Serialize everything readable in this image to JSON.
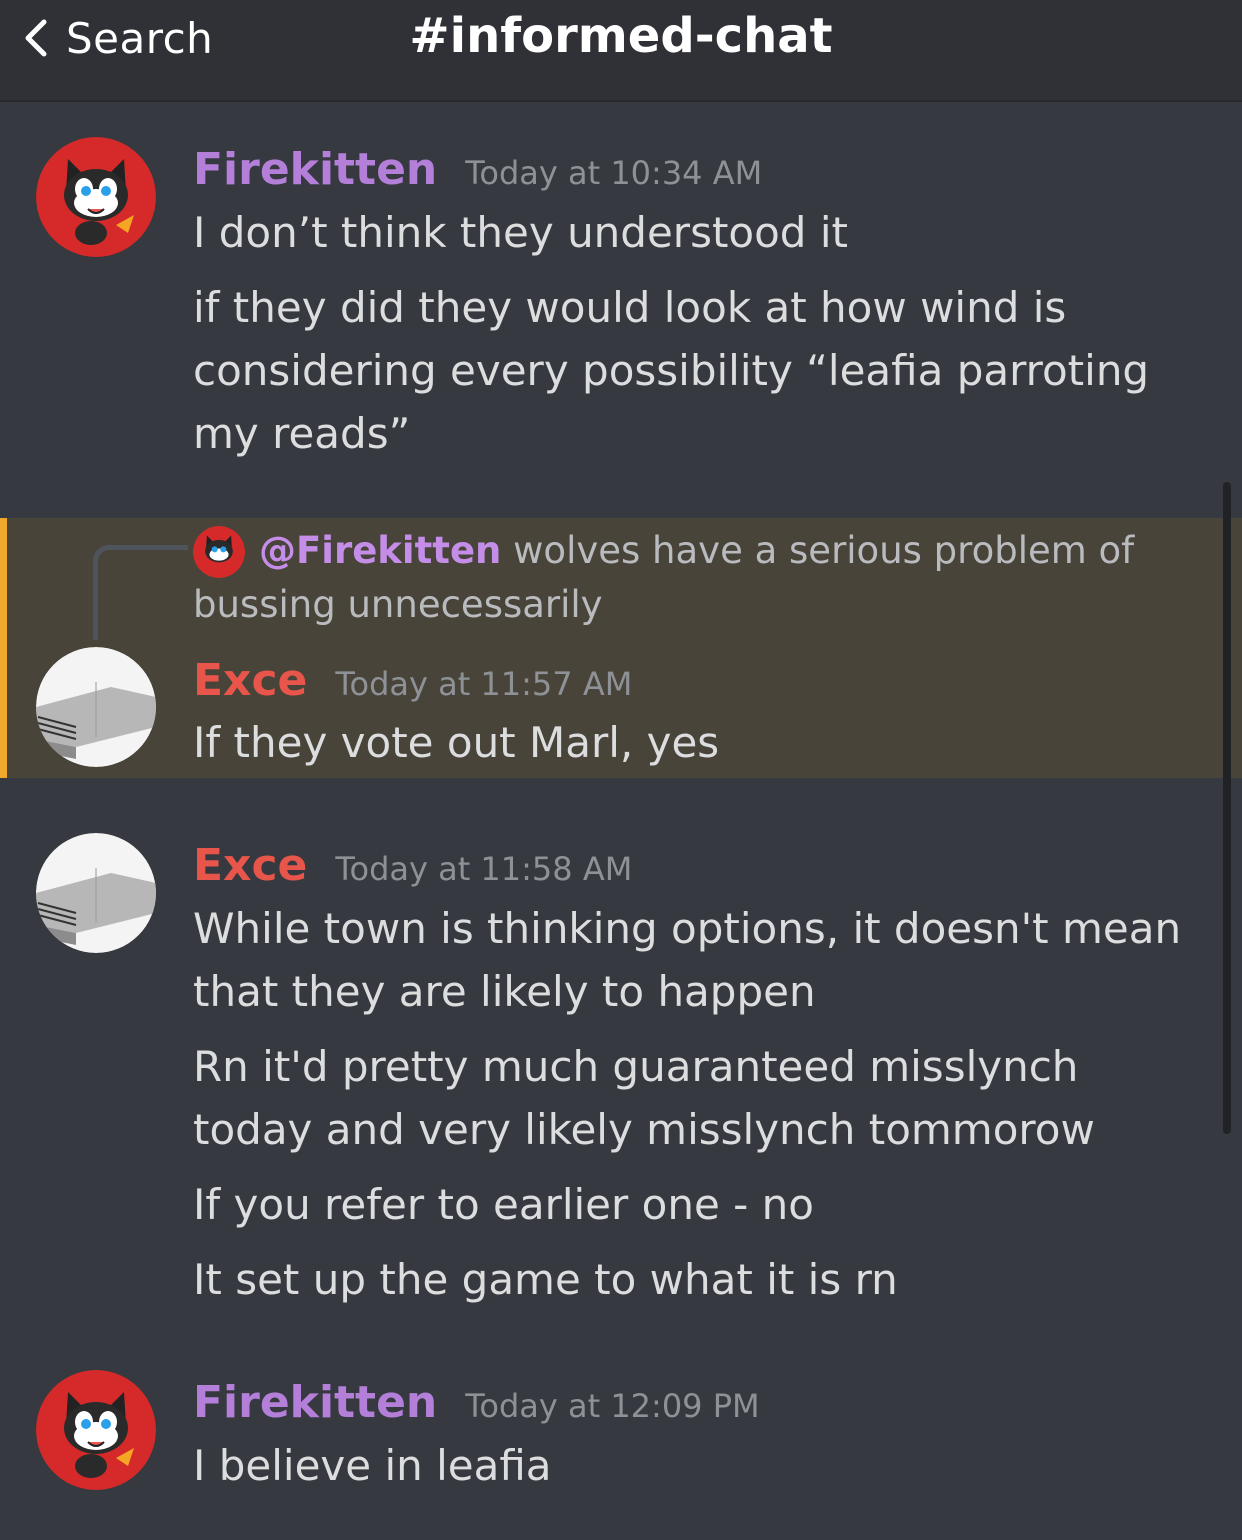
{
  "header": {
    "back_label": "Search",
    "channel": "#informed-chat"
  },
  "messages": [
    {
      "author": "Firekitten",
      "timestamp": "Today at 10:34 AM",
      "lines": [
        "I don’t think they understood it",
        "if they did they would look at how wind is considering every possibility “leafia parroting my reads”"
      ]
    },
    {
      "reply": {
        "mention": "@Firekitten",
        "text": "wolves have a serious problem of bussing unnecessarily"
      },
      "author": "Exce",
      "timestamp": "Today at 11:57 AM",
      "lines": [
        "If they vote out Marl, yes"
      ]
    },
    {
      "author": "Exce",
      "timestamp": "Today at 11:58 AM",
      "lines": [
        "While town is thinking options, it doesn't mean that they are likely to happen",
        "Rn it'd pretty much guaranteed misslynch today and very likely misslynch tommorow",
        "If you refer to earlier one - no",
        "It set up the game to what it is rn"
      ]
    },
    {
      "author": "Firekitten",
      "timestamp": "Today at 12:09 PM",
      "lines": [
        "I believe in leafia"
      ]
    }
  ],
  "colors": {
    "background": "#36393f",
    "header_bg": "#2f3136",
    "firekitten_name": "#b37fd8",
    "exce_name": "#e8564b",
    "highlight_bg": "#49443a",
    "highlight_bar": "#f0a82d",
    "text": "#dcddde",
    "timestamp": "#8e9297"
  }
}
